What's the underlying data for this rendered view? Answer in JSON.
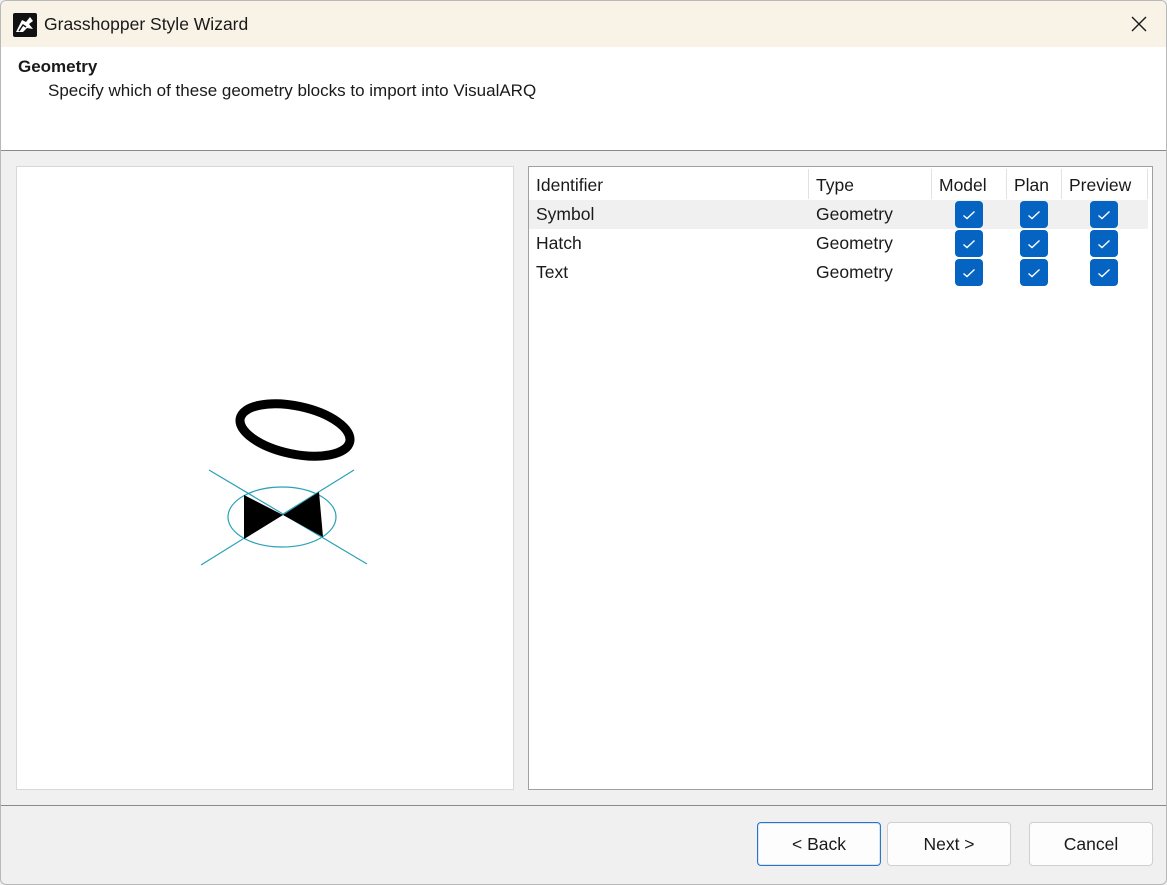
{
  "window": {
    "title": "Grasshopper Style Wizard",
    "close_icon": "close-icon"
  },
  "header": {
    "title": "Geometry",
    "subtitle": "Specify which of these geometry blocks to import into VisualARQ"
  },
  "grid": {
    "columns": [
      "Identifier",
      "Type",
      "Model",
      "Plan",
      "Preview"
    ],
    "rows": [
      {
        "identifier": "Symbol",
        "type": "Geometry",
        "model": true,
        "plan": true,
        "preview": true,
        "selected": true
      },
      {
        "identifier": "Hatch",
        "type": "Geometry",
        "model": true,
        "plan": true,
        "preview": true,
        "selected": false
      },
      {
        "identifier": "Text",
        "type": "Geometry",
        "model": true,
        "plan": true,
        "preview": true,
        "selected": false
      }
    ]
  },
  "buttons": {
    "back": "< Back",
    "next": "Next >",
    "cancel": "Cancel"
  },
  "colors": {
    "checkbox": "#0563c1",
    "titlebar": "#f8f3e6",
    "preview_lines": "#2aa1b8"
  }
}
